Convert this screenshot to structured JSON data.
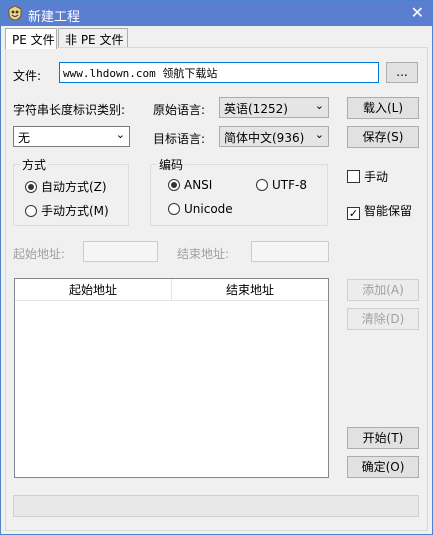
{
  "window": {
    "title": "新建工程",
    "close_glyph": "✕"
  },
  "tabs": [
    {
      "label": "PE 文件"
    },
    {
      "label": "非 PE 文件"
    }
  ],
  "file": {
    "label": "文件:",
    "value": "www.lhdown.com 领航下载站",
    "browse_label": "..."
  },
  "string_length": {
    "label": "字符串长度标识类别:",
    "selected": "无"
  },
  "source_language": {
    "label": "原始语言:",
    "selected": "英语(1252)"
  },
  "target_language": {
    "label": "目标语言:",
    "selected": "简体中文(936)"
  },
  "mode": {
    "legend": "方式",
    "auto": "自动方式(Z)",
    "manual": "手动方式(M)",
    "selected": "auto"
  },
  "encoding": {
    "legend": "编码",
    "ansi": "ANSI",
    "utf8": "UTF-8",
    "unicode": "Unicode",
    "selected": "ANSI"
  },
  "options": {
    "manual_label": "手动",
    "manual_checked": false,
    "smart_keep_label": "智能保留",
    "smart_keep_checked": true
  },
  "address": {
    "start_label": "起始地址:",
    "end_label": "结束地址:"
  },
  "table": {
    "columns": [
      "起始地址",
      "结束地址"
    ],
    "rows": []
  },
  "buttons": {
    "load": "载入(L)",
    "save": "保存(S)",
    "add": "添加(A)",
    "clear": "清除(D)",
    "start": "开始(T)",
    "ok": "确定(O)"
  },
  "colors": {
    "titlebar": "#5b7fd0",
    "accent_focus": "#0078d7"
  }
}
